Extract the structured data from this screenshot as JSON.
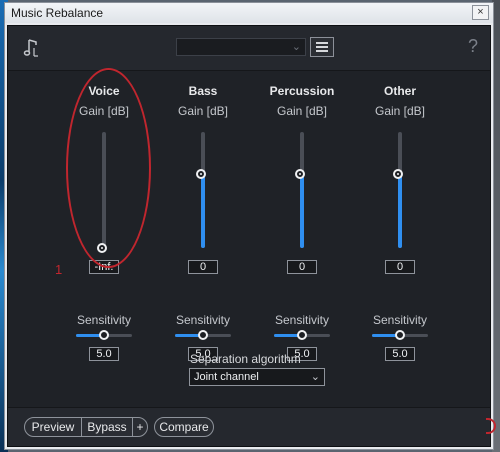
{
  "window": {
    "title": "Music Rebalance",
    "close_label": "×"
  },
  "toolbar": {
    "preset_value": "",
    "help_label": "?"
  },
  "channels": [
    {
      "name": "Voice",
      "gain_label": "Gain [dB]",
      "gain_value": "-Inf.",
      "gain_level": 0.0,
      "sensitivity_label": "Sensitivity",
      "sensitivity_value": "5.0",
      "sensitivity_level": 0.5
    },
    {
      "name": "Bass",
      "gain_label": "Gain [dB]",
      "gain_value": "0",
      "gain_level": 0.64,
      "sensitivity_label": "Sensitivity",
      "sensitivity_value": "5.0",
      "sensitivity_level": 0.5
    },
    {
      "name": "Percussion",
      "gain_label": "Gain [dB]",
      "gain_value": "0",
      "gain_level": 0.64,
      "sensitivity_label": "Sensitivity",
      "sensitivity_value": "5.0",
      "sensitivity_level": 0.5
    },
    {
      "name": "Other",
      "gain_label": "Gain [dB]",
      "gain_value": "0",
      "gain_level": 0.64,
      "sensitivity_label": "Sensitivity",
      "sensitivity_value": "5.0",
      "sensitivity_level": 0.5
    }
  ],
  "separation": {
    "label": "Separation algorithm",
    "value": "Joint channel"
  },
  "bottom": {
    "preview": "Preview",
    "bypass": "Bypass",
    "plus": "+",
    "compare": "Compare"
  },
  "annotation": {
    "number": "1"
  },
  "colors": {
    "accent": "#2f8ff0",
    "annotation": "#c0262e",
    "panel": "#1f2227"
  }
}
